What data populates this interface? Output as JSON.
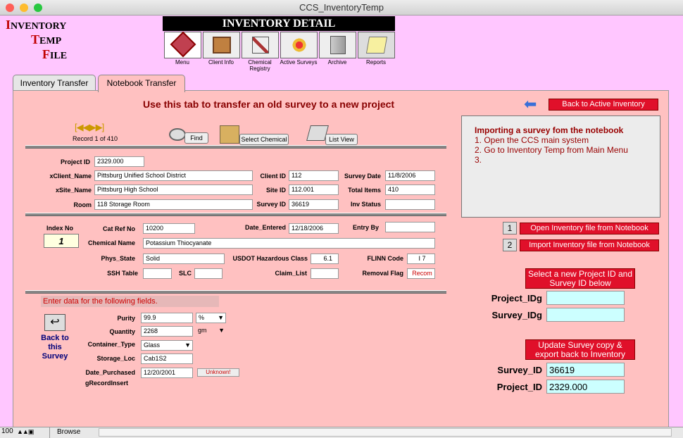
{
  "window": {
    "title": "CCS_InventoryTemp"
  },
  "logo": {
    "line1a": "I",
    "line1b": "NVENTORY",
    "line2a": "T",
    "line2b": "EMP",
    "line3a": "F",
    "line3b": "ILE"
  },
  "header": {
    "title": "INVENTORY DETAIL"
  },
  "nav": [
    {
      "label": "Menu",
      "icon": "css-logo-icon"
    },
    {
      "label": "Client Info",
      "icon": "client-info-icon"
    },
    {
      "label": "Chemical Registry",
      "icon": "chemical-registry-icon"
    },
    {
      "label": "Active Surveys",
      "icon": "active-surveys-icon"
    },
    {
      "label": "Archive",
      "icon": "archive-icon"
    },
    {
      "label": "Reports",
      "icon": "reports-icon"
    }
  ],
  "tabs": {
    "inventory_transfer": "Inventory Transfer",
    "notebook_transfer": "Notebook Transfer"
  },
  "main": {
    "instruction": "Use this tab to transfer an old survey to a new project",
    "back_button": "Back to Active  Inventory",
    "record": "Record 1 of 410",
    "find": "Find",
    "select_chemical": "Select Chemical",
    "list_view": "List View",
    "info_box": {
      "title": "Importing a survey fom the notebook",
      "step1": "1. Open the CCS main system",
      "step2": "2.  Go to Inventory Temp from Main Menu",
      "step3": "3."
    },
    "labels": {
      "project_id": "Project ID",
      "client_name": "xClient_Name",
      "client_id": "Client ID",
      "survey_date": "Survey Date",
      "site_name": "xSite_Name",
      "site_id": "Site ID",
      "total_items": "Total Items",
      "room": "Room",
      "survey_id": "Survey ID",
      "inv_status": "Inv Status",
      "index_no": "Index No",
      "cat_ref_no": "Cat Ref No",
      "date_entered": "Date_Entered",
      "entry_by": "Entry By",
      "chemical_name": "Chemical Name",
      "phys_state": "Phys_State",
      "usdot": "USDOT Hazardous Class",
      "flinn_code": "FLINN Code",
      "ssh_table": "SSH Table",
      "slc": "SLC",
      "claim_list": "Claim_List",
      "removal_flag": "Removal Flag",
      "purity": "Purity",
      "quantity": "Quantity",
      "container_type": "Container_Type",
      "storage_loc": "Storage_Loc",
      "date_purchased": "Date_Purchased",
      "grecordinsert": "gRecordInsert"
    },
    "values": {
      "project_id": "2329.000",
      "client_name": "Pittsburg Unified School District",
      "client_id": "112",
      "survey_date": "11/8/2006",
      "site_name": "Pittsburg High School",
      "site_id": "112.001",
      "total_items": "410",
      "room": "118 Storage Room",
      "survey_id": "36619",
      "inv_status": "",
      "index_no": "1",
      "cat_ref_no": "10200",
      "date_entered": "12/18/2006",
      "entry_by": "",
      "chemical_name": "Potassium Thiocyanate",
      "phys_state": "Solid",
      "usdot": "6.1",
      "flinn_code": "I 7",
      "ssh_table": "",
      "slc": "",
      "claim_list": "",
      "removal_flag": "Recom",
      "purity": "99.9",
      "purity_unit": "%",
      "quantity": "2268",
      "quantity_unit": "gm",
      "container_type": "Glass",
      "storage_loc": "Cab1S2",
      "date_purchased": "12/20/2001"
    },
    "enter_data": "Enter data for the following fields.",
    "unknown_button": "Unknown!",
    "back_to_survey": "Back to this Survey",
    "open_inventory": "Open Inventory file from Notebook",
    "import_inventory": "Import Inventory file from Notebook",
    "step_1": "1",
    "step_2": "2",
    "select_new": "Select a new Project ID and Survey ID below",
    "project_idg": "Project_IDg",
    "survey_idg": "Survey_IDg",
    "update_survey": "Update Survey copy & export back to Inventory",
    "survey_id_label": "Survey_ID",
    "project_id_label": "Project_ID",
    "survey_id_value": "36619",
    "project_id_value": "2329.000"
  },
  "statusbar": {
    "zoom": "100",
    "mode": "Browse"
  }
}
